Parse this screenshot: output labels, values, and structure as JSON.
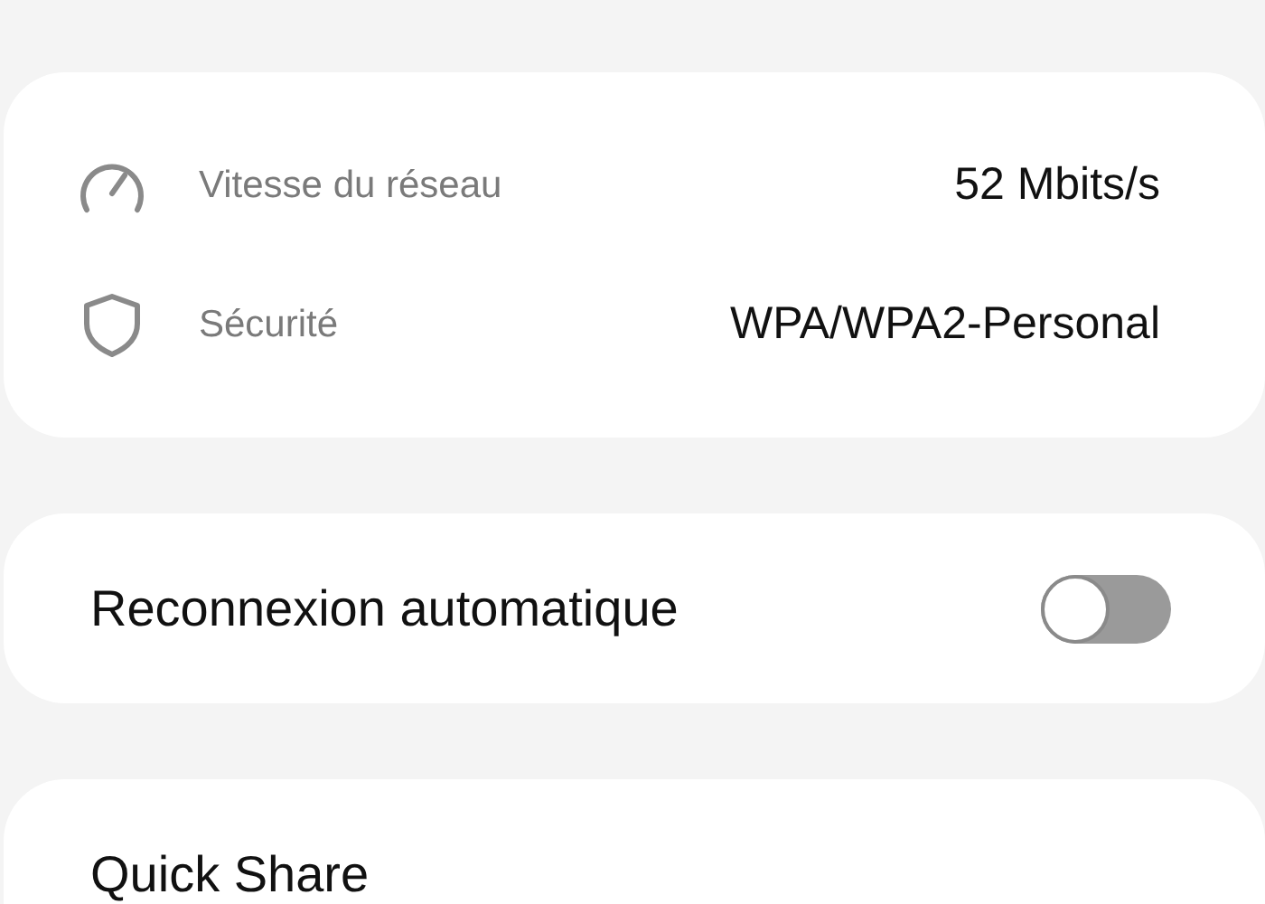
{
  "network_info": [
    {
      "kind": "speed",
      "label": "Vitesse du réseau",
      "value": "52 Mbits/s"
    },
    {
      "kind": "security",
      "label": "Sécurité",
      "value": "WPA/WPA2-Personal"
    }
  ],
  "auto_reconnect": {
    "label": "Reconnexion automatique",
    "on": false
  },
  "quick_share": {
    "label": "Quick Share"
  }
}
